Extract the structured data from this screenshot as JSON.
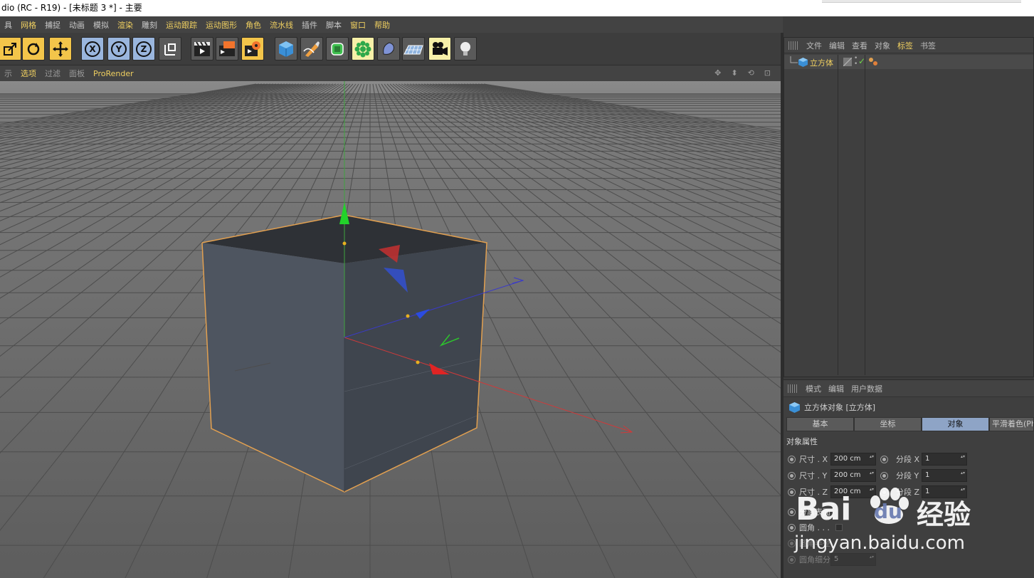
{
  "window": {
    "title": "dio (RC - R19) - [未标题 3 *] - 主要"
  },
  "menubar": {
    "items": [
      {
        "label": "具",
        "hl": false
      },
      {
        "label": "网格",
        "hl": true
      },
      {
        "label": "捕捉",
        "hl": false
      },
      {
        "label": "动画",
        "hl": false
      },
      {
        "label": "模拟",
        "hl": false
      },
      {
        "label": "渲染",
        "hl": true
      },
      {
        "label": "雕刻",
        "hl": false
      },
      {
        "label": "运动跟踪",
        "hl": true
      },
      {
        "label": "运动图形",
        "hl": true
      },
      {
        "label": "角色",
        "hl": true
      },
      {
        "label": "流水线",
        "hl": true
      },
      {
        "label": "插件",
        "hl": false
      },
      {
        "label": "脚本",
        "hl": false
      },
      {
        "label": "窗口",
        "hl": true
      },
      {
        "label": "帮助",
        "hl": true
      }
    ]
  },
  "toolbar": {
    "axis_x": "X",
    "axis_y": "Y",
    "axis_z": "Z"
  },
  "viewport_menu": {
    "items": [
      "示",
      "选项",
      "过滤",
      "面板",
      "ProRender"
    ]
  },
  "object_manager": {
    "menu": [
      "文件",
      "编辑",
      "查看",
      "对象",
      "标签",
      "书签"
    ],
    "objects": [
      {
        "name": "立方体"
      }
    ]
  },
  "attribute_manager": {
    "menu": [
      "模式",
      "编辑",
      "用户数据"
    ],
    "title": "立方体对象 [立方体]",
    "tabs": [
      "基本",
      "坐标",
      "对象",
      "平滑着色(Phong)"
    ],
    "active_tab": "对象",
    "section": "对象属性",
    "properties": [
      {
        "label": "尺寸 . X",
        "value": "200 cm",
        "seg_label": "分段 X",
        "seg_value": "1"
      },
      {
        "label": "尺寸 . Y",
        "value": "200 cm",
        "seg_label": "分段 Y",
        "seg_value": "1"
      },
      {
        "label": "尺寸 . Z",
        "value": "200 cm",
        "seg_label": "分段 Z",
        "seg_value": "1"
      }
    ],
    "extra_rows": [
      {
        "label": "分离表面"
      },
      {
        "label": "圆角 . . ."
      },
      {
        "label": "圆角半径"
      },
      {
        "label": "圆角细分",
        "value": "5"
      }
    ]
  },
  "watermark": {
    "brand": "Bai",
    "brand2": "du",
    "suffix": "经验",
    "url": "jingyan.baidu.com"
  },
  "colors": {
    "accent": "#f0d060",
    "active_tab": "#8ea4c6",
    "selection": "#e0a050"
  }
}
